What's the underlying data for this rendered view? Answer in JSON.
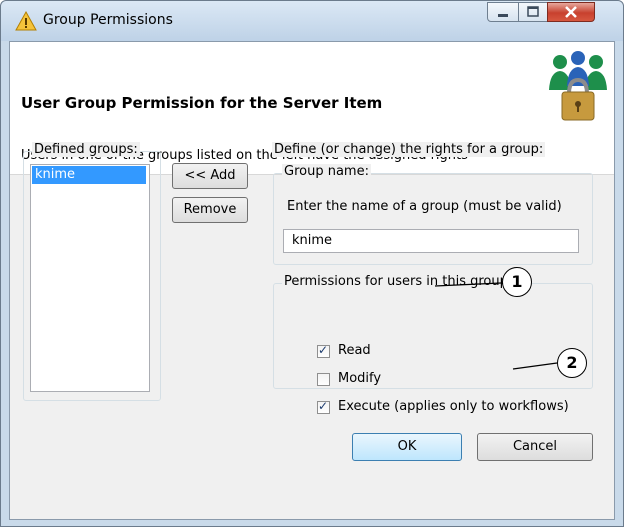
{
  "window": {
    "title": "Group Permissions",
    "minimize_label": "–",
    "maximize_label": "▢",
    "close_label": "x"
  },
  "header": {
    "title": "User Group Permission for the Server Item",
    "description": "Users in one of the groups listed on the left have the assigned rights"
  },
  "groups": {
    "legend": "Defined groups:",
    "items": [
      "knime"
    ],
    "selected_index": 0
  },
  "buttons": {
    "add": "<< Add",
    "remove": "Remove",
    "ok": "OK",
    "cancel": "Cancel"
  },
  "rights": {
    "legend": "Define (or change) the rights for a group:",
    "group_name_legend": "Group name:",
    "group_name_instruction": "Enter the name of a group (must be valid)",
    "group_name_value": "knime",
    "permissions_legend": "Permissions for users in this group",
    "permissions": [
      {
        "label": "Read",
        "checked": true
      },
      {
        "label": "Modify",
        "checked": false
      },
      {
        "label": "Execute (applies only to workflows)",
        "checked": true
      }
    ]
  },
  "callouts": [
    "1",
    "2"
  ],
  "icons": {
    "title": "warning-triangle-icon",
    "header": "user-group-lock-icon"
  }
}
